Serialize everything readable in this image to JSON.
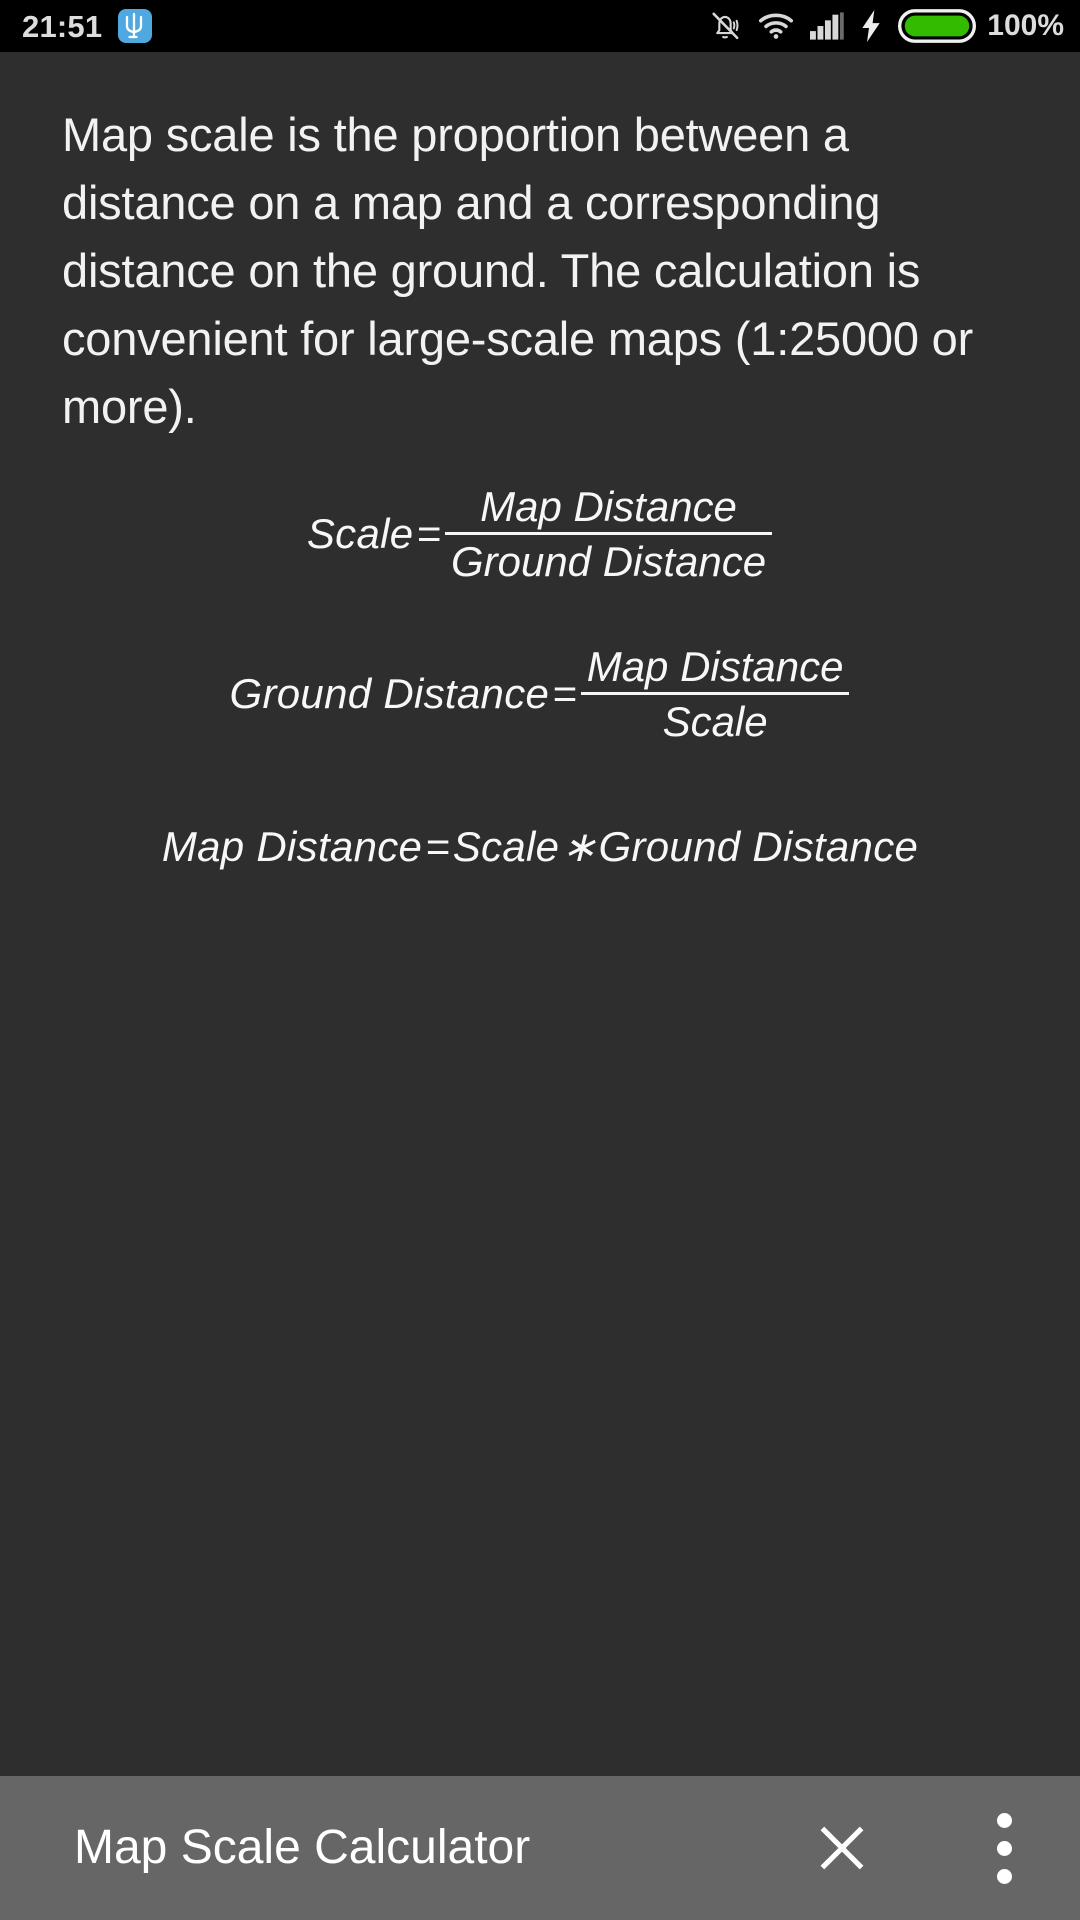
{
  "status_bar": {
    "time": "21:51",
    "usb_icon_label": "trident-usb-debug",
    "icons": [
      "bell-muted-icon",
      "wifi-icon",
      "signal-bars-icon",
      "charging-bolt-icon",
      "battery-icon"
    ],
    "battery_percent": "100%",
    "battery_color": "#33bb00",
    "usb_badge_color": "#4fa8e0"
  },
  "content": {
    "intro_paragraph": "Map scale is the proportion between a distance on a map and a corresponding distance on the ground. The calculation is convenient for large-scale maps (1:25000 or more).",
    "formulas": [
      {
        "id": "scale-formula",
        "lhs": "Scale",
        "equals": "=",
        "numerator": "Map Distance",
        "denominator": "Ground Distance"
      },
      {
        "id": "ground-distance-formula",
        "lhs": "Ground Distance",
        "equals": "=",
        "numerator": "Map Distance",
        "denominator": "Scale"
      },
      {
        "id": "map-distance-formula",
        "lhs": "Map Distance",
        "equals": "=",
        "rhs_left": "Scale",
        "operator": "∗",
        "rhs_right": "Ground Distance"
      }
    ]
  },
  "bottom_bar": {
    "app_title": "Map Scale Calculator",
    "close_label": "close-icon",
    "overflow_label": "overflow-menu-icon",
    "background_color": "#666666"
  },
  "theme": {
    "background": "#2e2e2e",
    "text_color": "#f2f2f2",
    "status_bar_background": "#000000"
  }
}
